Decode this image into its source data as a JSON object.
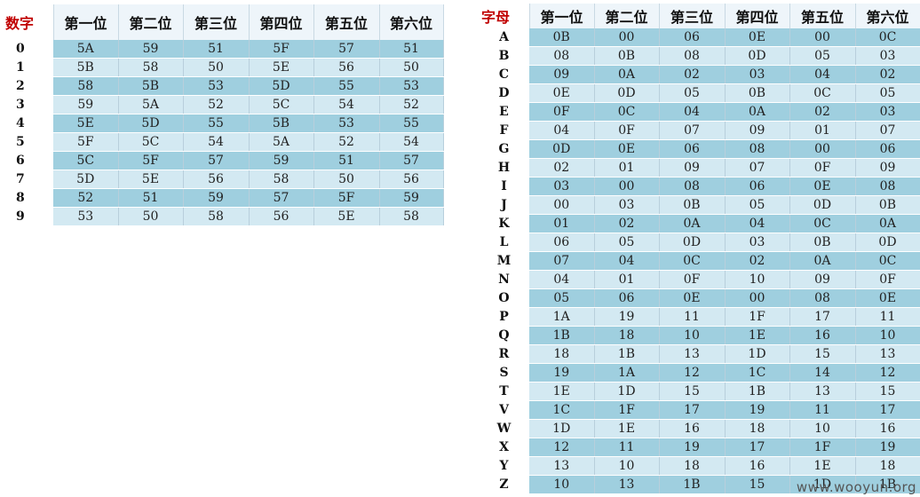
{
  "left_table": {
    "corner": "数字",
    "headers": [
      "第一位",
      "第二位",
      "第三位",
      "第四位",
      "第五位",
      "第六位"
    ],
    "rows": [
      {
        "key": "0",
        "values": [
          "5A",
          "59",
          "51",
          "5F",
          "57",
          "51"
        ]
      },
      {
        "key": "1",
        "values": [
          "5B",
          "58",
          "50",
          "5E",
          "56",
          "50"
        ]
      },
      {
        "key": "2",
        "values": [
          "58",
          "5B",
          "53",
          "5D",
          "55",
          "53"
        ]
      },
      {
        "key": "3",
        "values": [
          "59",
          "5A",
          "52",
          "5C",
          "54",
          "52"
        ]
      },
      {
        "key": "4",
        "values": [
          "5E",
          "5D",
          "55",
          "5B",
          "53",
          "55"
        ]
      },
      {
        "key": "5",
        "values": [
          "5F",
          "5C",
          "54",
          "5A",
          "52",
          "54"
        ]
      },
      {
        "key": "6",
        "values": [
          "5C",
          "5F",
          "57",
          "59",
          "51",
          "57"
        ]
      },
      {
        "key": "7",
        "values": [
          "5D",
          "5E",
          "56",
          "58",
          "50",
          "56"
        ]
      },
      {
        "key": "8",
        "values": [
          "52",
          "51",
          "59",
          "57",
          "5F",
          "59"
        ]
      },
      {
        "key": "9",
        "values": [
          "53",
          "50",
          "58",
          "56",
          "5E",
          "58"
        ]
      }
    ]
  },
  "right_table": {
    "corner": "字母",
    "headers": [
      "第一位",
      "第二位",
      "第三位",
      "第四位",
      "第五位",
      "第六位"
    ],
    "rows": [
      {
        "key": "A",
        "values": [
          "0B",
          "00",
          "06",
          "0E",
          "00",
          "0C"
        ]
      },
      {
        "key": "B",
        "values": [
          "08",
          "0B",
          "08",
          "0D",
          "05",
          "03"
        ]
      },
      {
        "key": "C",
        "values": [
          "09",
          "0A",
          "02",
          "03",
          "04",
          "02"
        ]
      },
      {
        "key": "D",
        "values": [
          "0E",
          "0D",
          "05",
          "0B",
          "0C",
          "05"
        ]
      },
      {
        "key": "E",
        "values": [
          "0F",
          "0C",
          "04",
          "0A",
          "02",
          "03"
        ]
      },
      {
        "key": "F",
        "values": [
          "04",
          "0F",
          "07",
          "09",
          "01",
          "07"
        ]
      },
      {
        "key": "G",
        "values": [
          "0D",
          "0E",
          "06",
          "08",
          "00",
          "06"
        ]
      },
      {
        "key": "H",
        "values": [
          "02",
          "01",
          "09",
          "07",
          "0F",
          "09"
        ]
      },
      {
        "key": "I",
        "values": [
          "03",
          "00",
          "08",
          "06",
          "0E",
          "08"
        ]
      },
      {
        "key": "J",
        "values": [
          "00",
          "03",
          "0B",
          "05",
          "0D",
          "0B"
        ]
      },
      {
        "key": "K",
        "values": [
          "01",
          "02",
          "0A",
          "04",
          "0C",
          "0A"
        ]
      },
      {
        "key": "L",
        "values": [
          "06",
          "05",
          "0D",
          "03",
          "0B",
          "0D"
        ]
      },
      {
        "key": "M",
        "values": [
          "07",
          "04",
          "0C",
          "02",
          "0A",
          "0C"
        ]
      },
      {
        "key": "N",
        "values": [
          "04",
          "01",
          "0F",
          "10",
          "09",
          "0F"
        ]
      },
      {
        "key": "O",
        "values": [
          "05",
          "06",
          "0E",
          "00",
          "08",
          "0E"
        ]
      },
      {
        "key": "P",
        "values": [
          "1A",
          "19",
          "11",
          "1F",
          "17",
          "11"
        ]
      },
      {
        "key": "Q",
        "values": [
          "1B",
          "18",
          "10",
          "1E",
          "16",
          "10"
        ]
      },
      {
        "key": "R",
        "values": [
          "18",
          "1B",
          "13",
          "1D",
          "15",
          "13"
        ]
      },
      {
        "key": "S",
        "values": [
          "19",
          "1A",
          "12",
          "1C",
          "14",
          "12"
        ]
      },
      {
        "key": "T",
        "values": [
          "1E",
          "1D",
          "15",
          "1B",
          "13",
          "15"
        ]
      },
      {
        "key": "V",
        "values": [
          "1C",
          "1F",
          "17",
          "19",
          "11",
          "17"
        ]
      },
      {
        "key": "W",
        "values": [
          "1D",
          "1E",
          "16",
          "18",
          "10",
          "16"
        ]
      },
      {
        "key": "X",
        "values": [
          "12",
          "11",
          "19",
          "17",
          "1F",
          "19"
        ]
      },
      {
        "key": "Y",
        "values": [
          "13",
          "10",
          "18",
          "16",
          "1E",
          "18"
        ]
      },
      {
        "key": "Z",
        "values": [
          "10",
          "13",
          "1B",
          "15",
          "1D",
          "1B"
        ]
      }
    ]
  },
  "watermark": "www.wooyun.org",
  "colors": {
    "stripe_dark": "#9fcfdf",
    "stripe_light": "#d3e9f2",
    "header_bg": "#eef5fa",
    "corner_text": "#c00000"
  }
}
